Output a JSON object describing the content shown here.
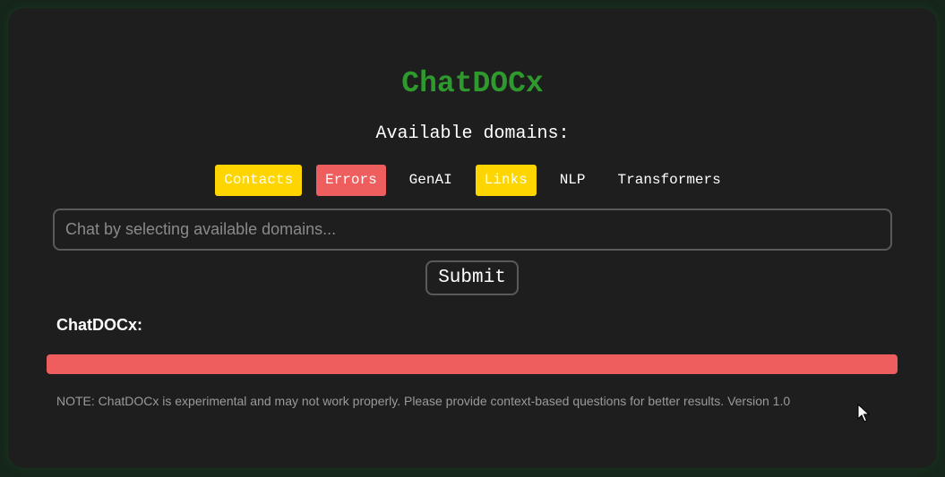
{
  "app": {
    "title": "ChatDOCx"
  },
  "domains": {
    "heading": "Available domains:",
    "items": [
      {
        "label": "Contacts",
        "state": "highlighted",
        "color": "#ffd500"
      },
      {
        "label": "Errors",
        "state": "error",
        "color": "#ee5e5e"
      },
      {
        "label": "GenAI",
        "state": "plain",
        "color": ""
      },
      {
        "label": "Links",
        "state": "highlighted",
        "color": "#ffd500"
      },
      {
        "label": "NLP",
        "state": "plain",
        "color": ""
      },
      {
        "label": "Transformers",
        "state": "plain",
        "color": ""
      }
    ]
  },
  "chat": {
    "placeholder": "Chat by selecting available domains...",
    "value": "",
    "submit_label": "Submit"
  },
  "response": {
    "label": "ChatDOCx:",
    "bar_color": "#ee5e5e"
  },
  "footer": {
    "note": "NOTE: ChatDOCx is experimental and may not work properly. Please provide context-based questions for better results. Version 1.0"
  },
  "colors": {
    "title": "#2e9a2e",
    "background": "#1e1e1e",
    "highlight": "#ffd500",
    "error": "#ee5e5e"
  },
  "icons": {
    "cursor": "mouse-pointer-icon"
  }
}
